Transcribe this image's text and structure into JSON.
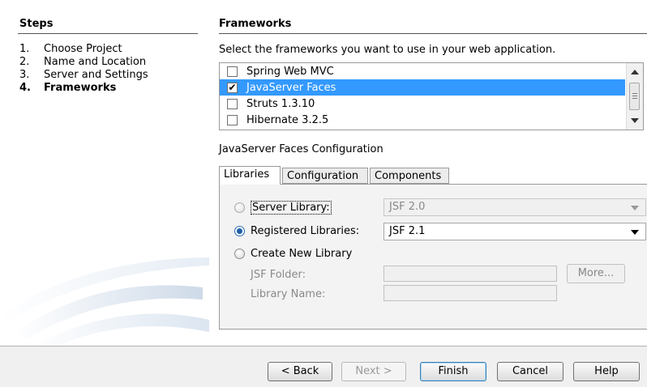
{
  "steps": {
    "title": "Steps",
    "items": [
      {
        "num": "1.",
        "label": "Choose Project"
      },
      {
        "num": "2.",
        "label": "Name and Location"
      },
      {
        "num": "3.",
        "label": "Server and Settings"
      },
      {
        "num": "4.",
        "label": "Frameworks"
      }
    ],
    "current": 4
  },
  "frameworks": {
    "title": "Frameworks",
    "instructions": "Select the frameworks you want to use in your web application.",
    "items": [
      {
        "label": "Spring Web MVC",
        "checked": false,
        "selected": false
      },
      {
        "label": "JavaServer Faces",
        "checked": true,
        "selected": true
      },
      {
        "label": "Struts 1.3.10",
        "checked": false,
        "selected": false
      },
      {
        "label": "Hibernate 3.2.5",
        "checked": false,
        "selected": false
      }
    ]
  },
  "config": {
    "heading": "JavaServer Faces Configuration",
    "tabs": [
      {
        "label": "Libraries",
        "active": true
      },
      {
        "label": "Configuration",
        "active": false
      },
      {
        "label": "Components",
        "active": false
      }
    ],
    "server_library": {
      "label": "Server Library:",
      "value": "JSF 2.0",
      "selected": false
    },
    "registered_libraries": {
      "label": "Registered Libraries:",
      "value": "JSF 2.1",
      "selected": true
    },
    "create_new_library": {
      "label": "Create New Library",
      "selected": false
    },
    "jsf_folder": {
      "label": "JSF Folder:",
      "value": ""
    },
    "library_name": {
      "label": "Library Name:",
      "value": ""
    },
    "more_label": "More..."
  },
  "buttons": {
    "back": "< Back",
    "next": "Next >",
    "finish": "Finish",
    "cancel": "Cancel",
    "help": "Help"
  }
}
